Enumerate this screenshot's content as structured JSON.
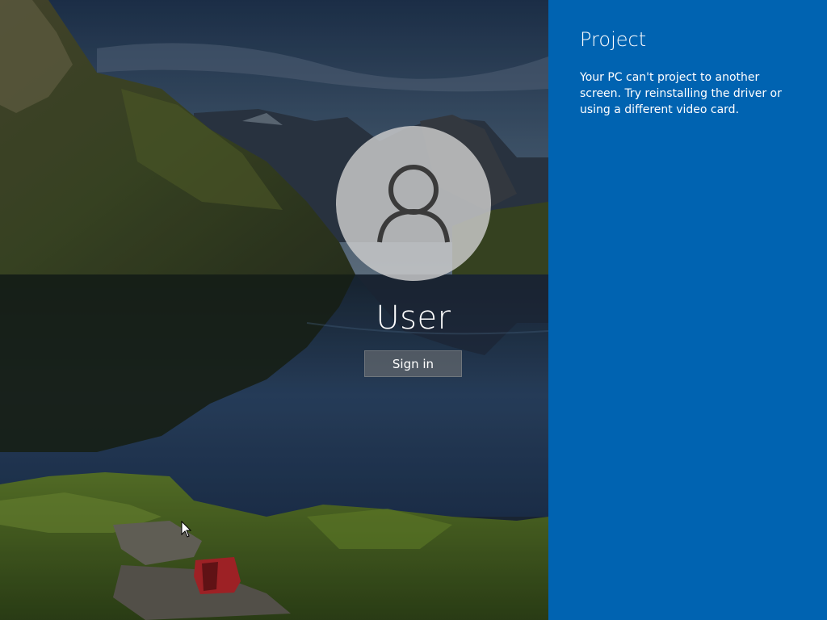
{
  "lock_screen": {
    "user_name": "User",
    "signin_label": "Sign in",
    "avatar_icon": "user-icon"
  },
  "project_panel": {
    "title": "Project",
    "message": "Your PC can't project to another screen. Try reinstalling the driver or using a different video card.",
    "background_color": "#0063b1"
  },
  "cursor": {
    "icon": "arrow-pointer-icon"
  }
}
